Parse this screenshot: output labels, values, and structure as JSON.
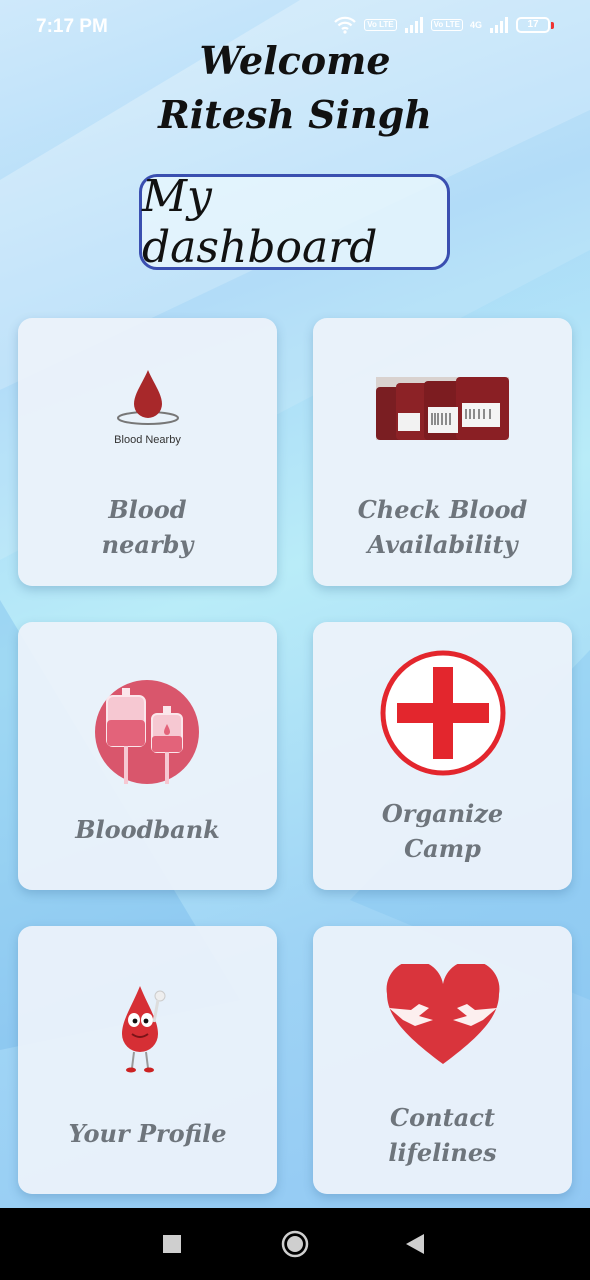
{
  "status_bar": {
    "time": "7:17 PM",
    "volte_1": "Vo LTE",
    "volte_2": "Vo LTE",
    "network": "4G",
    "battery": "17"
  },
  "header": {
    "welcome": "Welcome",
    "user_name": "Ritesh Singh",
    "dashboard_title": "My dashboard"
  },
  "cards": [
    {
      "label_line1": "Blood",
      "label_line2": "nearby",
      "icon": "blood-drop-icon",
      "icon_caption": "Blood Nearby"
    },
    {
      "label_line1": "Check Blood",
      "label_line2": "Availability",
      "icon": "blood-bags-photo"
    },
    {
      "label_line1": "Bloodbank",
      "icon": "blood-bank-bags-icon"
    },
    {
      "label_line1": "Organize",
      "label_line2": "Camp",
      "icon": "red-cross-icon"
    },
    {
      "label_line1": "Your Profile",
      "icon": "blood-drop-mascot-icon"
    },
    {
      "label_line1": "Contact",
      "label_line2": "lifelines",
      "icon": "heart-hands-icon"
    }
  ],
  "colors": {
    "accent_border": "#3a4fb0",
    "blood_red": "#e3262d",
    "label_gray": "#6e757c"
  },
  "nav": {
    "recents_icon": "square-icon",
    "home_icon": "circle-icon",
    "back_icon": "triangle-back-icon"
  }
}
